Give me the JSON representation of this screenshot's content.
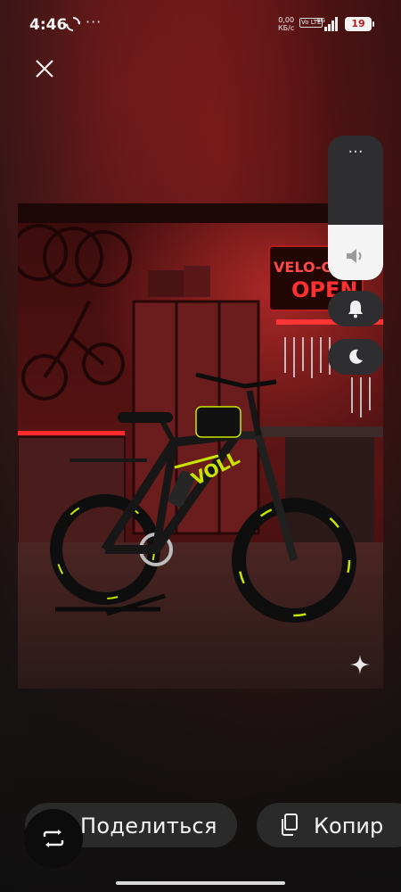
{
  "status_bar": {
    "time": "4:46",
    "more": "···",
    "net_speed_value": "0,00",
    "net_speed_unit": "КБ/с",
    "volte": "Vo LTE",
    "network": "4G",
    "battery": "19"
  },
  "photo": {
    "neon_sign_line1": "VELO-GAR",
    "neon_sign_line2": "OPEN",
    "bike_brand": "VOLL"
  },
  "volume_panel": {
    "more": "···",
    "level_percent": 38
  },
  "actions": {
    "share_label": "Поделиться",
    "copy_label": "Копир"
  },
  "icons": {
    "close": "close-icon",
    "sync": "sync-icon",
    "speaker": "speaker-icon",
    "bell": "bell-icon",
    "moon": "moon-icon",
    "copy": "copy-icon",
    "repeat": "repeat-icon",
    "sparkle": "sparkle-icon"
  },
  "colors": {
    "neon_red": "#ff2a2a",
    "bike_accent": "#c9e600",
    "panel_bg": "#2e2e30"
  }
}
